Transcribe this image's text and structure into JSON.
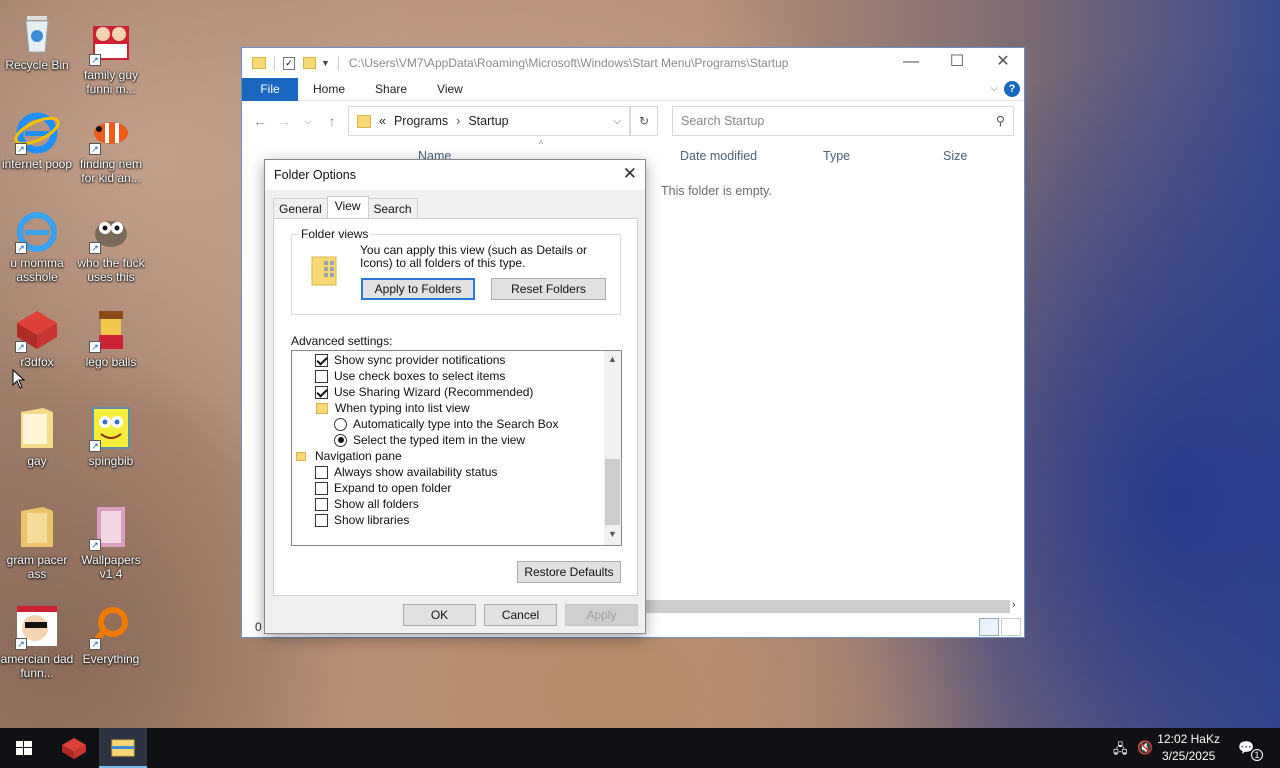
{
  "desktop": {
    "icons": [
      {
        "label": "Recycle Bin",
        "icon": "recycle-bin-icon"
      },
      {
        "label": "family guy funni m...",
        "icon": "family-guy-icon"
      },
      {
        "label": "internet poop",
        "icon": "internet-explorer-icon"
      },
      {
        "label": "finding nem for kid an...",
        "icon": "fish-icon"
      },
      {
        "label": "u momma asshole",
        "icon": "internet-explorer-icon"
      },
      {
        "label": "who the fuck uses this",
        "icon": "gimp-icon"
      },
      {
        "label": "r3dfox",
        "icon": "red-cube-icon"
      },
      {
        "label": "lego balls",
        "icon": "lego-figure-icon"
      },
      {
        "label": "gay",
        "icon": "folder-icon"
      },
      {
        "label": "spingbib",
        "icon": "spongebob-icon"
      },
      {
        "label": "gram pacer ass",
        "icon": "folder-icon"
      },
      {
        "label": "Wallpapers v1.4",
        "icon": "wallpaper-book-icon"
      },
      {
        "label": "amercian dad funn...",
        "icon": "american-dad-icon"
      },
      {
        "label": "Everything",
        "icon": "everything-search-icon"
      }
    ]
  },
  "explorer": {
    "path": "C:\\Users\\VM7\\AppData\\Roaming\\Microsoft\\Windows\\Start Menu\\Programs\\Startup",
    "ribbon": {
      "file": "File",
      "tabs": [
        "Home",
        "Share",
        "View"
      ]
    },
    "breadcrumb": {
      "prefix": "«",
      "parts": [
        "Programs",
        "Startup"
      ]
    },
    "search_placeholder": "Search Startup",
    "columns": [
      "Name",
      "Date modified",
      "Type",
      "Size"
    ],
    "empty_message": "This folder is empty.",
    "status_count": "0"
  },
  "dialog": {
    "title": "Folder Options",
    "tabs": [
      "General",
      "View",
      "Search"
    ],
    "active_tab": "View",
    "folder_views": {
      "legend": "Folder views",
      "text": "You can apply this view (such as Details or Icons) to all folders of this type.",
      "apply_button": "Apply to Folders",
      "reset_button": "Reset Folders"
    },
    "advanced_label": "Advanced settings:",
    "settings": [
      {
        "type": "checkbox",
        "checked": true,
        "indent": 1,
        "label": "Show sync provider notifications"
      },
      {
        "type": "checkbox",
        "checked": false,
        "indent": 1,
        "label": "Use check boxes to select items"
      },
      {
        "type": "checkbox",
        "checked": true,
        "indent": 1,
        "label": "Use Sharing Wizard (Recommended)"
      },
      {
        "type": "folder",
        "indent": 1,
        "label": "When typing into list view"
      },
      {
        "type": "radio",
        "checked": false,
        "indent": 2,
        "label": "Automatically type into the Search Box"
      },
      {
        "type": "radio",
        "checked": true,
        "indent": 2,
        "label": "Select the typed item in the view"
      },
      {
        "type": "folder",
        "indent": 0,
        "label": "Navigation pane"
      },
      {
        "type": "checkbox",
        "checked": false,
        "indent": 1,
        "label": "Always show availability status"
      },
      {
        "type": "checkbox",
        "checked": false,
        "indent": 1,
        "label": "Expand to open folder"
      },
      {
        "type": "checkbox",
        "checked": false,
        "indent": 1,
        "label": "Show all folders"
      },
      {
        "type": "checkbox",
        "checked": false,
        "indent": 1,
        "label": "Show libraries"
      }
    ],
    "restore_button": "Restore Defaults",
    "ok_button": "OK",
    "cancel_button": "Cancel",
    "apply_button": "Apply"
  },
  "taskbar": {
    "time": "12:02 HaKz",
    "date": "3/25/2025",
    "notification_count": "1"
  }
}
